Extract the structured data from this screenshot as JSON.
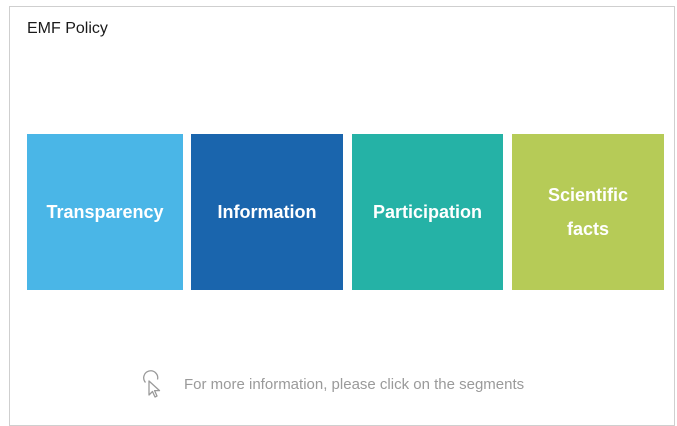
{
  "panel": {
    "title": "EMF Policy"
  },
  "segments": [
    {
      "label": "Transparency",
      "color": "#4ab6e7"
    },
    {
      "label": "Information",
      "color": "#1a65ad"
    },
    {
      "label": "Participation",
      "color": "#25b2a6"
    },
    {
      "label": "Scientific\nfacts",
      "color": "#b6cb57"
    }
  ],
  "hint": {
    "icon": "pointer-click-icon",
    "text": "For more information, please click on the segments",
    "color": "#9a9a9a"
  }
}
